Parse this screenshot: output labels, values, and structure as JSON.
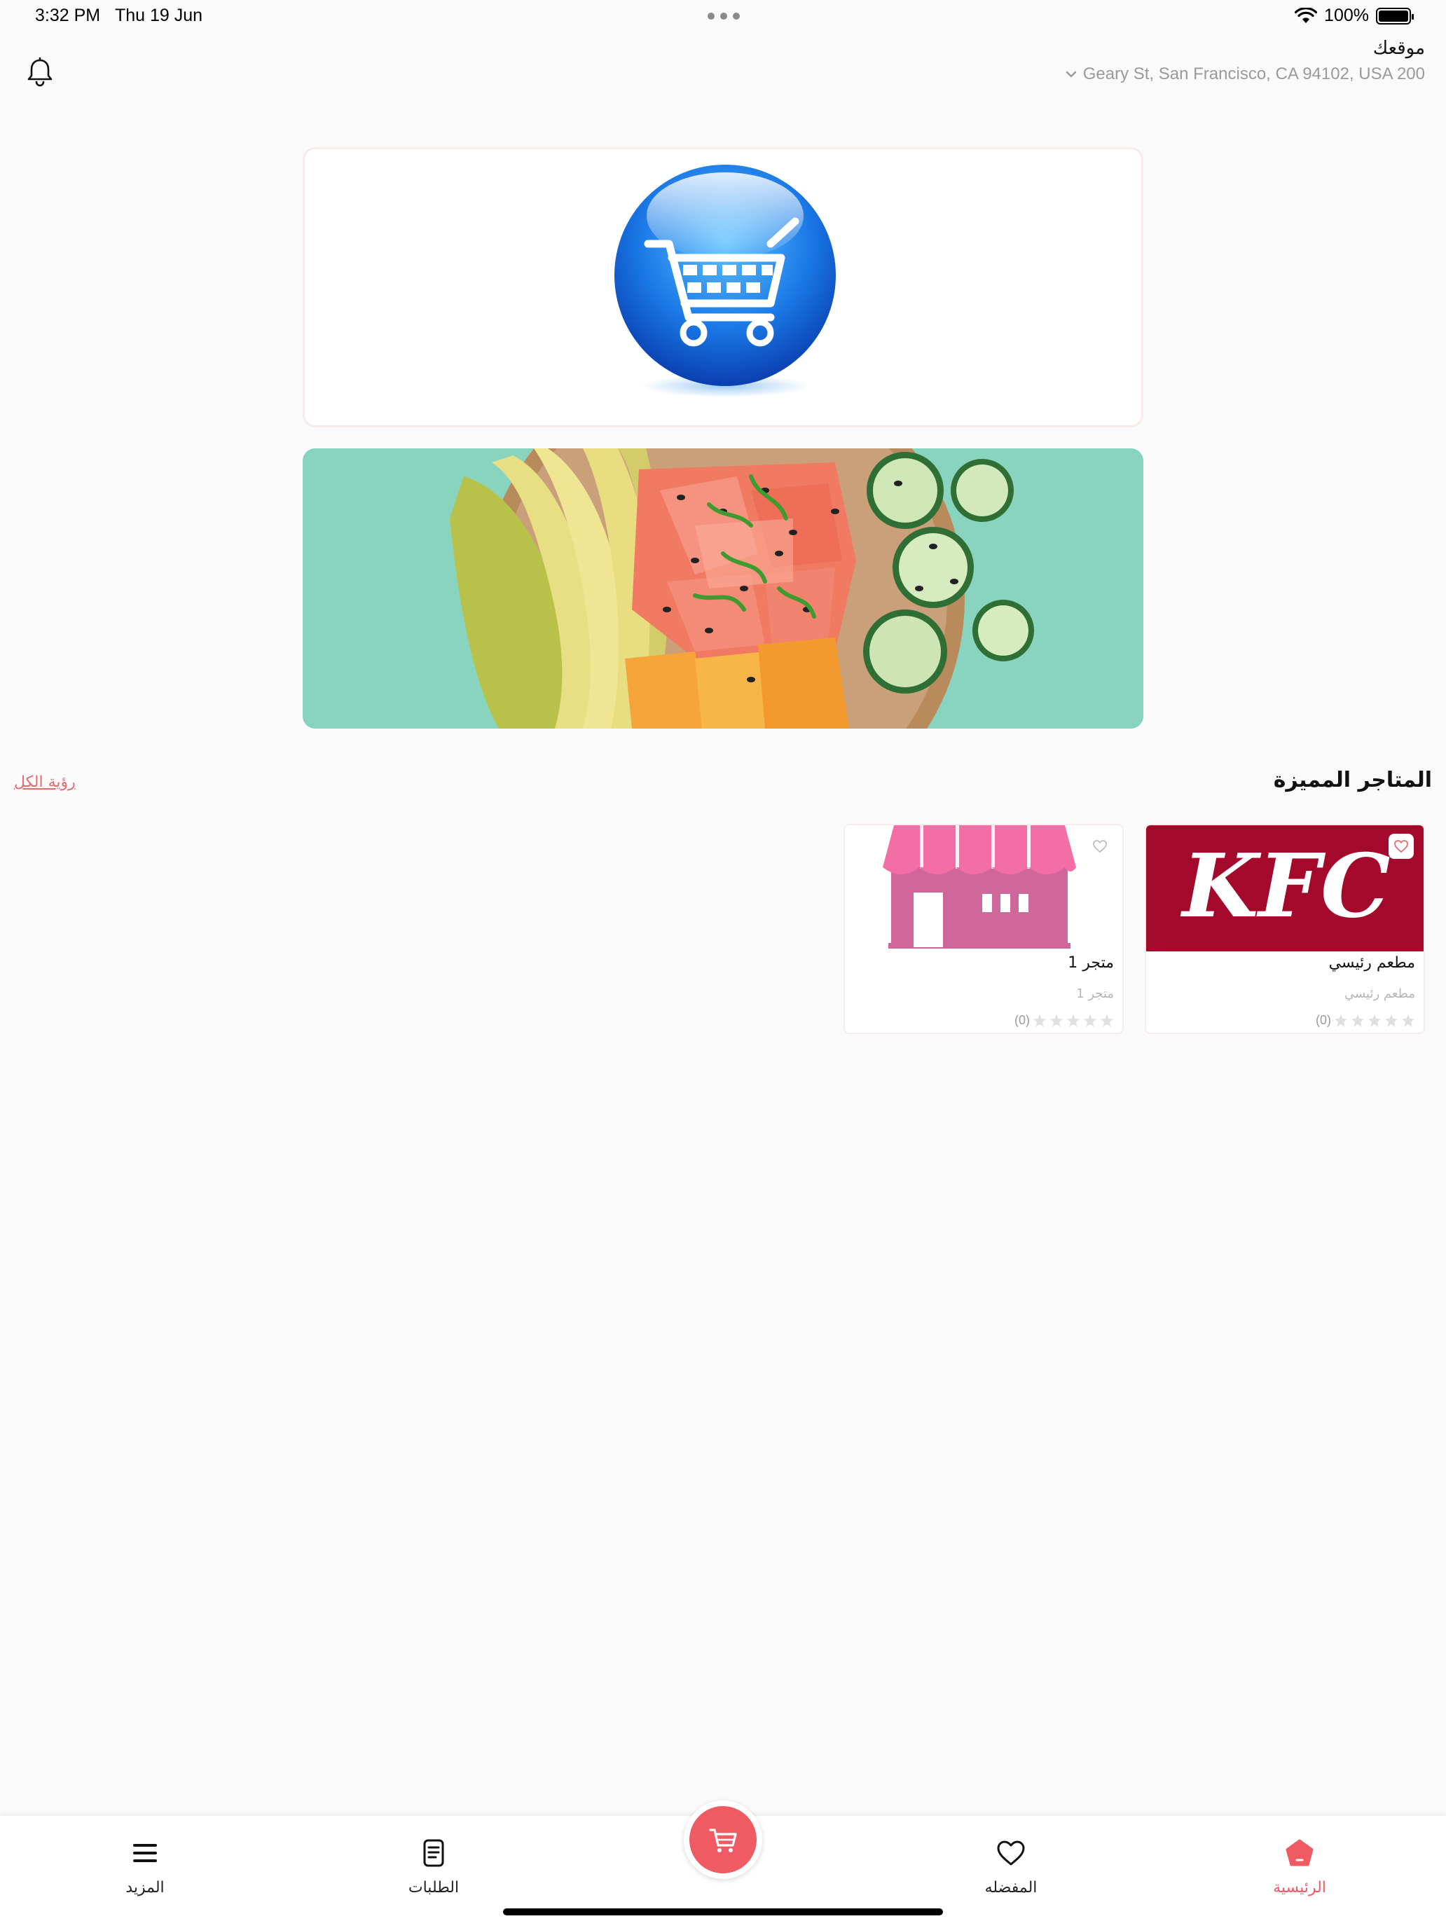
{
  "status_bar": {
    "time": "3:32 PM",
    "date": "Thu 19 Jun",
    "battery": "100%",
    "battery_level": 1.0
  },
  "header": {
    "location_title": "موقعك",
    "address": "Geary St, San Francisco, CA 94102, USA 200",
    "icons": [
      "bell-icon",
      "chevron-down-icon"
    ]
  },
  "banners": [
    {
      "name": "shopping-cart-banner"
    },
    {
      "name": "poke-bowl-banner"
    }
  ],
  "featured": {
    "title": "المتاجر المميزة",
    "see_all": "رؤية الكل",
    "stores": [
      {
        "name": "مطعم رئيسي",
        "subtitle": "مطعم رئيسي",
        "rating_count": "(0)",
        "logo_text": "KFC",
        "stars": 0
      },
      {
        "name": "متجر 1",
        "subtitle": "متجر 1",
        "rating_count": "(0)",
        "stars": 0
      }
    ]
  },
  "bottom_nav": {
    "more": "المزيد",
    "orders": "الطلبات",
    "favorites": "المفضله",
    "home": "الرئيسية",
    "active": "home"
  },
  "colors": {
    "accent": "#ef5a63",
    "kfc_red": "#a4082b",
    "store_pink": "#d0679a",
    "background": "#fbfafa"
  }
}
